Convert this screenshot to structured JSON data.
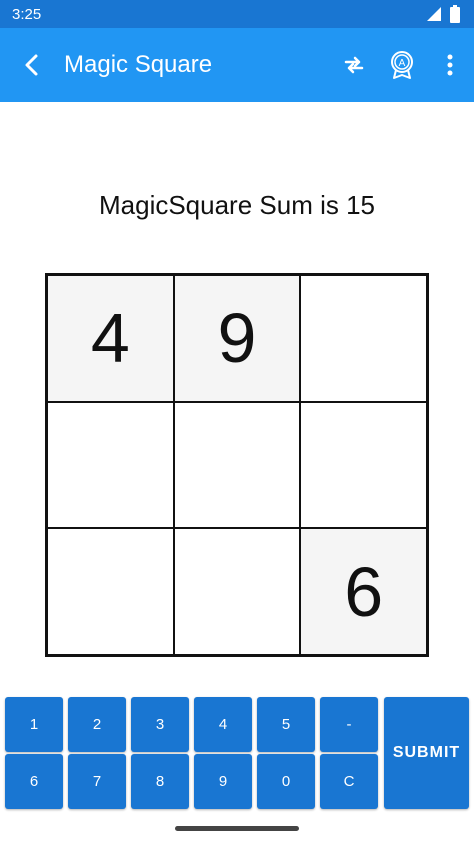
{
  "status_bar": {
    "time": "3:25"
  },
  "app_bar": {
    "title": "Magic Square",
    "actions": [
      "swap-icon",
      "award-icon",
      "more-icon"
    ]
  },
  "puzzle": {
    "sum_label": "MagicSquare Sum is 15",
    "cells": [
      [
        "4",
        "9",
        ""
      ],
      [
        "",
        "",
        ""
      ],
      [
        "",
        "",
        "6"
      ]
    ]
  },
  "keypad": {
    "row1": [
      "1",
      "2",
      "3",
      "4",
      "5",
      "-"
    ],
    "row2": [
      "6",
      "7",
      "8",
      "9",
      "0",
      "C"
    ],
    "submit": "SUBMIT"
  },
  "colors": {
    "status_bar": "#1976D2",
    "app_bar": "#2196F3",
    "key": "#1976D2",
    "given_cell": "#f5f5f5"
  }
}
